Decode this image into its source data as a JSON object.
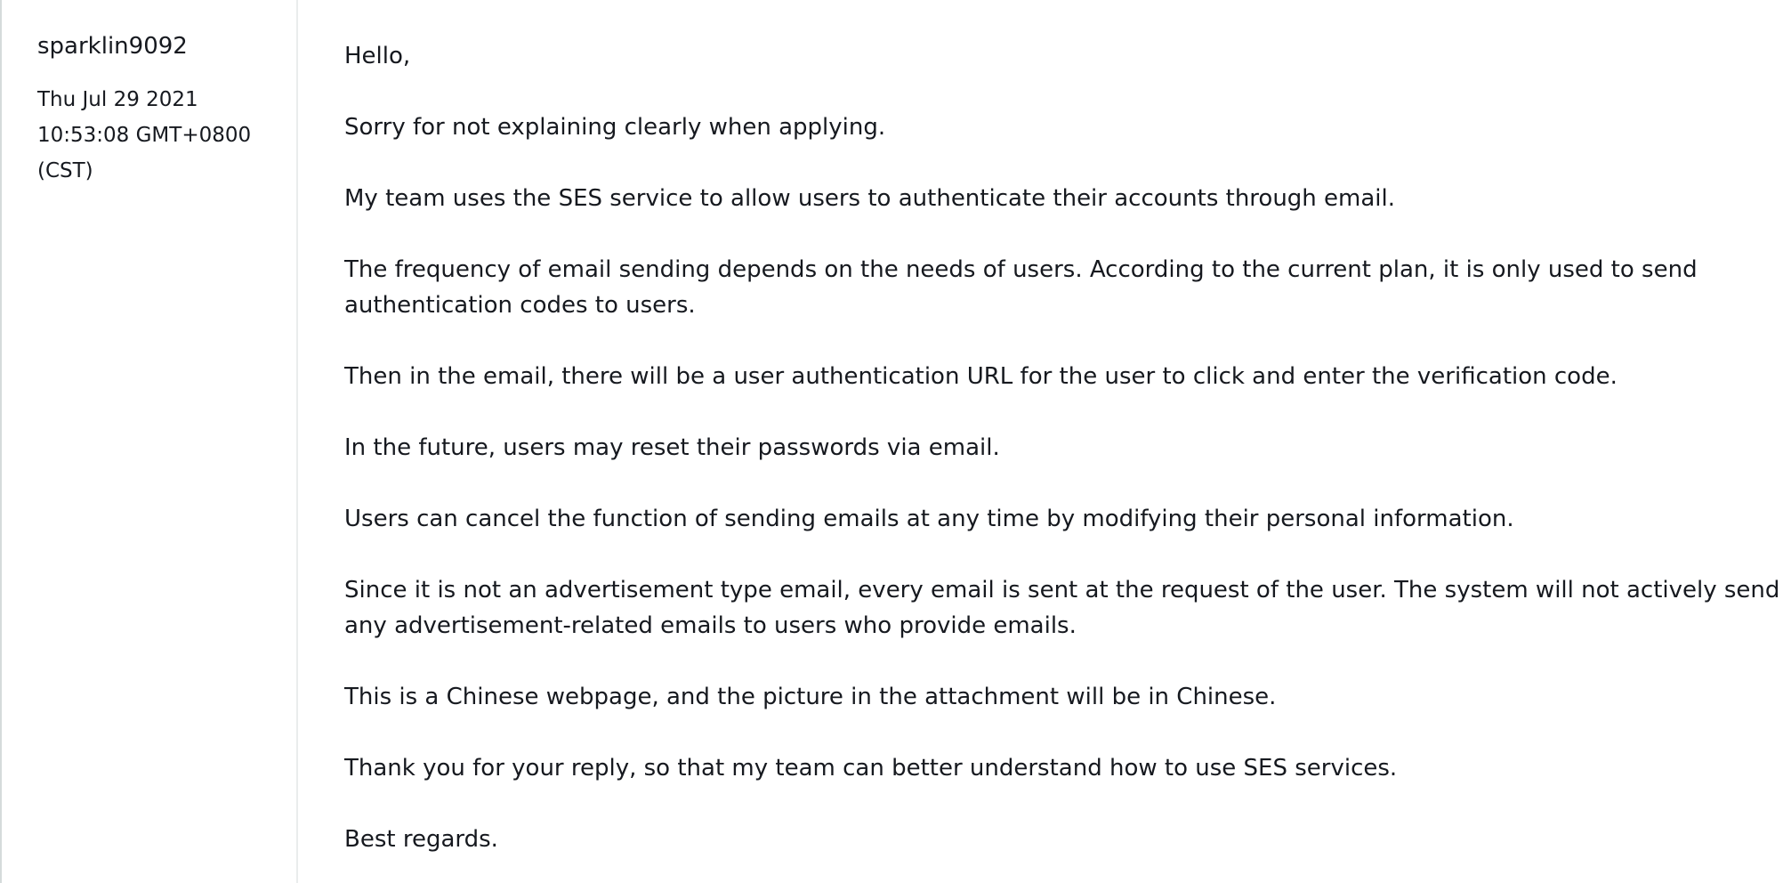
{
  "author": "sparklin9092",
  "timestamp": {
    "line1": "Thu Jul 29 2021",
    "line2": "10:53:08 GMT+0800",
    "line3": "(CST)"
  },
  "body": {
    "p1": "Hello,",
    "p2": "Sorry for not explaining clearly when applying.",
    "p3": "My team uses the SES service to allow users to authenticate their accounts through email.",
    "p4_l1": "The frequency of email sending depends on the needs of users. According to the current plan, it is only used to send",
    "p4_l2": "authentication codes to users.",
    "p5": "Then in the email, there will be a user authentication URL for the user to click and enter the verification code.",
    "p6": "In the future, users may reset their passwords via email.",
    "p7": "Users can cancel the function of sending emails at any time by modifying their personal information.",
    "p8_l1": "Since it is not an advertisement type email, every email is sent at the request of the user. The system will not actively send",
    "p8_l2": "any advertisement-related emails to users who provide emails.",
    "p9": "This is a Chinese webpage, and the picture in the attachment will be in Chinese.",
    "p10": "Thank you for your reply, so that my team can better understand how to use SES services.",
    "p11": "Best regards."
  }
}
